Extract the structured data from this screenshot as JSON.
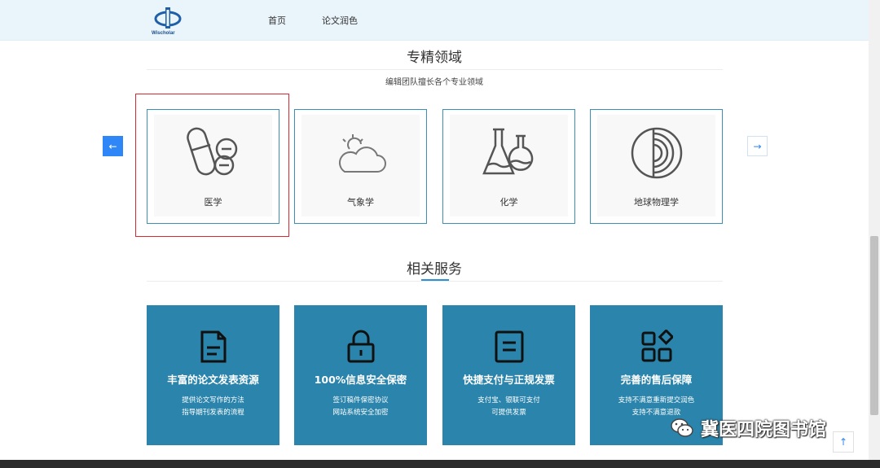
{
  "header": {
    "logo_text": "Wischolar",
    "nav": [
      "首页",
      "论文润色"
    ]
  },
  "fields_section": {
    "title": "专精领域",
    "subtitle": "编辑团队擅长各个专业领域",
    "prev_icon": "arrow-left-icon",
    "next_icon": "arrow-right-icon",
    "prev_glyph": "←",
    "next_glyph": "→",
    "cards": [
      {
        "label": "医学",
        "icon": "pills-icon"
      },
      {
        "label": "气象学",
        "icon": "cloud-sun-icon"
      },
      {
        "label": "化学",
        "icon": "flask-icon"
      },
      {
        "label": "地球物理学",
        "icon": "earth-layers-icon"
      }
    ]
  },
  "services_section": {
    "title": "相关服务",
    "cards": [
      {
        "title": "丰富的论文发表资源",
        "line1": "提供论文写作的方法",
        "line2": "指导期刊发表的流程",
        "icon": "document-icon"
      },
      {
        "title": "100%信息安全保密",
        "line1": "签订稿件保密协议",
        "line2": "网站系统安全加密",
        "icon": "lock-icon"
      },
      {
        "title": "快捷支付与正规发票",
        "line1": "支付宝、银联可支付",
        "line2": "可提供发票",
        "icon": "invoice-icon"
      },
      {
        "title": "完善的售后保障",
        "line1": "支持不满意重新提交润色",
        "line2": "支持不满意退款",
        "icon": "shapes-icon"
      }
    ]
  },
  "watermark": {
    "text": "冀医四院图书馆",
    "icon": "wechat-icon"
  },
  "back_to_top": {
    "icon": "arrow-up-icon",
    "glyph": "↑"
  },
  "colors": {
    "header_bg": "#eaf4fb",
    "card_border": "#3c8fb7",
    "service_bg": "#2a84ab",
    "accent": "#2f86f6",
    "highlight": "#d9282e"
  }
}
